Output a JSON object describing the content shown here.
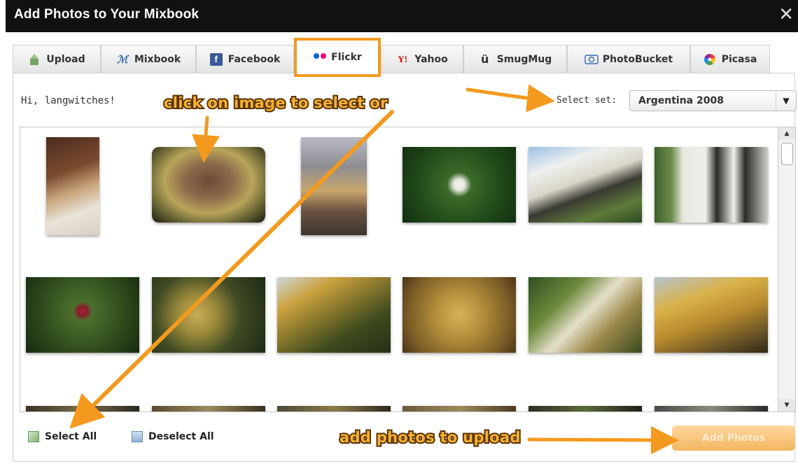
{
  "window": {
    "title": "Add Photos to Your Mixbook",
    "close": "✕"
  },
  "tabs": [
    {
      "label": "Upload",
      "icon": "upload-icon"
    },
    {
      "label": "Mixbook",
      "icon": "mixbook-icon"
    },
    {
      "label": "Facebook",
      "icon": "facebook-icon"
    },
    {
      "label": "Flickr",
      "icon": "flickr-icon",
      "active": true
    },
    {
      "label": "Yahoo",
      "icon": "yahoo-icon"
    },
    {
      "label": "SmugMug",
      "icon": "smugmug-icon"
    },
    {
      "label": "PhotoBucket",
      "icon": "photobucket-icon"
    },
    {
      "label": "Picasa",
      "icon": "picasa-icon"
    }
  ],
  "greeting": "Hi, langwitches!",
  "select_set": {
    "label": "Select set:",
    "value": "Argentina 2008"
  },
  "footer": {
    "select_all": "Select All",
    "deselect_all": "Deselect All",
    "add_photos": "Add Photos"
  },
  "annotations": {
    "click_hint": "click on image to select or",
    "upload_hint": "add photos to upload"
  },
  "photos": [
    "teddy-bear-restaurant",
    "grilled-meat-plate",
    "teddy-bear-with-meal",
    "white-camellia",
    "balcony-building",
    "white-house-door",
    "red-flower-foliage",
    "ginkgo-leaves",
    "autumn-tree",
    "yellow-leaves-ground",
    "leaf-branches",
    "yellow-tree-canopy"
  ],
  "colors": {
    "accent": "#f39a1e",
    "title_bg": "#111111",
    "add_button": "#f3b660"
  }
}
